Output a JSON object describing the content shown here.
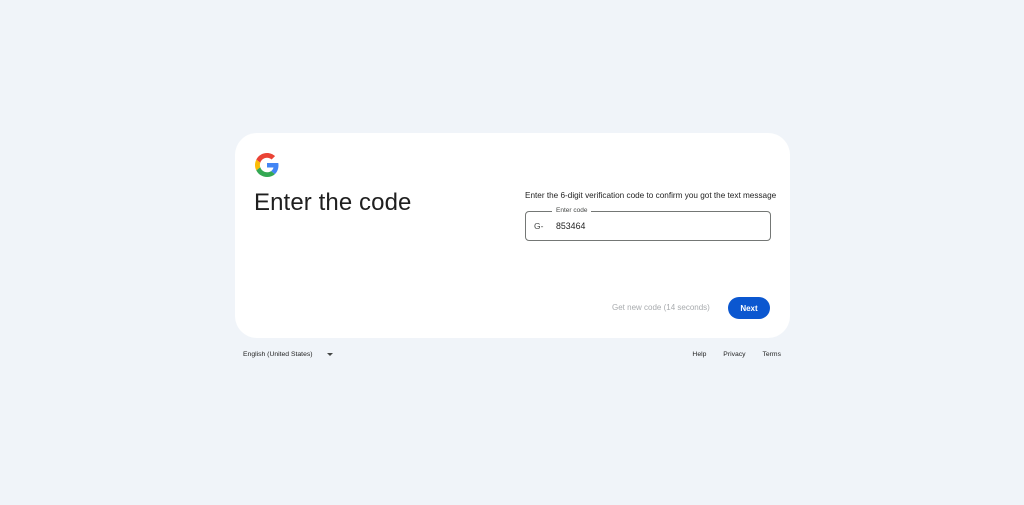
{
  "brand": {
    "logo_icon": "google-g-logo-icon",
    "colors": {
      "blue": "#4285F4",
      "red": "#EA4335",
      "yellow": "#FBBC05",
      "green": "#34A853"
    }
  },
  "page": {
    "title": "Enter the code"
  },
  "instruction": "Enter the 6-digit verification code to confirm you got the text message",
  "code_field": {
    "label": "Enter code",
    "prefix": "G-",
    "value": "853464"
  },
  "actions": {
    "get_new_code": "Get new code (14 seconds)",
    "next": "Next",
    "accent_color": "#0b57d0"
  },
  "footer": {
    "language": "English (United States)",
    "links": {
      "help": "Help",
      "privacy": "Privacy",
      "terms": "Terms"
    }
  }
}
